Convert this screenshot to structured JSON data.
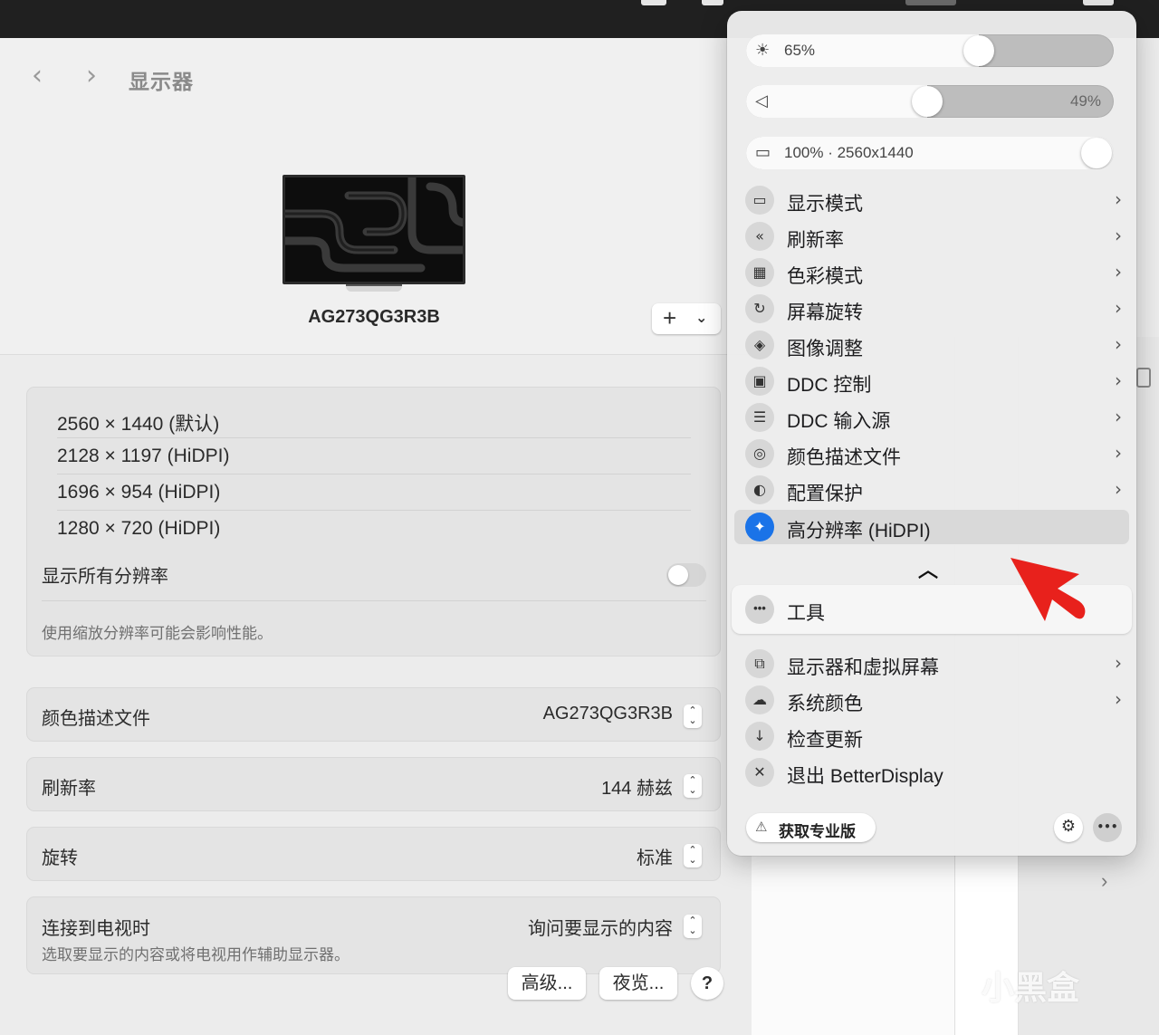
{
  "settings": {
    "title": "显示器",
    "display_name": "AG273QG3R3B",
    "resolutions": [
      "2560 × 1440 (默认)",
      "2128 × 1197 (HiDPI)",
      "1696 × 954 (HiDPI)",
      "1280 × 720 (HiDPI)"
    ],
    "show_all_label": "显示所有分辨率",
    "show_all_enabled": false,
    "res_note": "使用缩放分辨率可能会影响性能。",
    "color_profile": {
      "label": "颜色描述文件",
      "value": "AG273QG3R3B"
    },
    "refresh_rate": {
      "label": "刷新率",
      "value": "144 赫兹"
    },
    "rotation": {
      "label": "旋转",
      "value": "标准"
    },
    "tv": {
      "label": "连接到电视时",
      "value": "询问要显示的内容",
      "note": "选取要显示的内容或将电视用作辅助显示器。"
    },
    "buttons": {
      "advanced": "高级...",
      "night_shift": "夜览...",
      "help": "?"
    }
  },
  "panel": {
    "brightness": {
      "text": "65%",
      "level": 0.65
    },
    "volume": {
      "text": "49%",
      "level": 0.49
    },
    "scale": {
      "text": "100% · 2560x1440",
      "level": 1.0
    },
    "items": [
      {
        "label": "显示模式",
        "icon": "display-mode-icon"
      },
      {
        "label": "刷新率",
        "icon": "refresh-rate-icon"
      },
      {
        "label": "色彩模式",
        "icon": "color-mode-icon"
      },
      {
        "label": "屏幕旋转",
        "icon": "rotate-icon"
      },
      {
        "label": "图像调整",
        "icon": "image-adjust-icon"
      },
      {
        "label": "DDC 控制",
        "icon": "ddc-control-icon"
      },
      {
        "label": "DDC 输入源",
        "icon": "ddc-input-icon"
      },
      {
        "label": "颜色描述文件",
        "icon": "color-profile-icon"
      },
      {
        "label": "配置保护",
        "icon": "protection-icon"
      },
      {
        "label": "高分辨率 (HiDPI)",
        "icon": "sparkle-icon"
      }
    ],
    "tools_label": "工具",
    "extra_items": [
      {
        "label": "显示器和虚拟屏幕",
        "icon": "displays-icon"
      },
      {
        "label": "系统颜色",
        "icon": "system-color-icon"
      },
      {
        "label": "检查更新",
        "icon": "download-icon"
      },
      {
        "label": "退出 BetterDisplay",
        "icon": "close-icon"
      }
    ],
    "pro_button": "获取专业版"
  },
  "watermark": "小黑盒",
  "colors": {
    "accent_blue": "#1a73e8",
    "annotation_red": "#e8211c"
  }
}
